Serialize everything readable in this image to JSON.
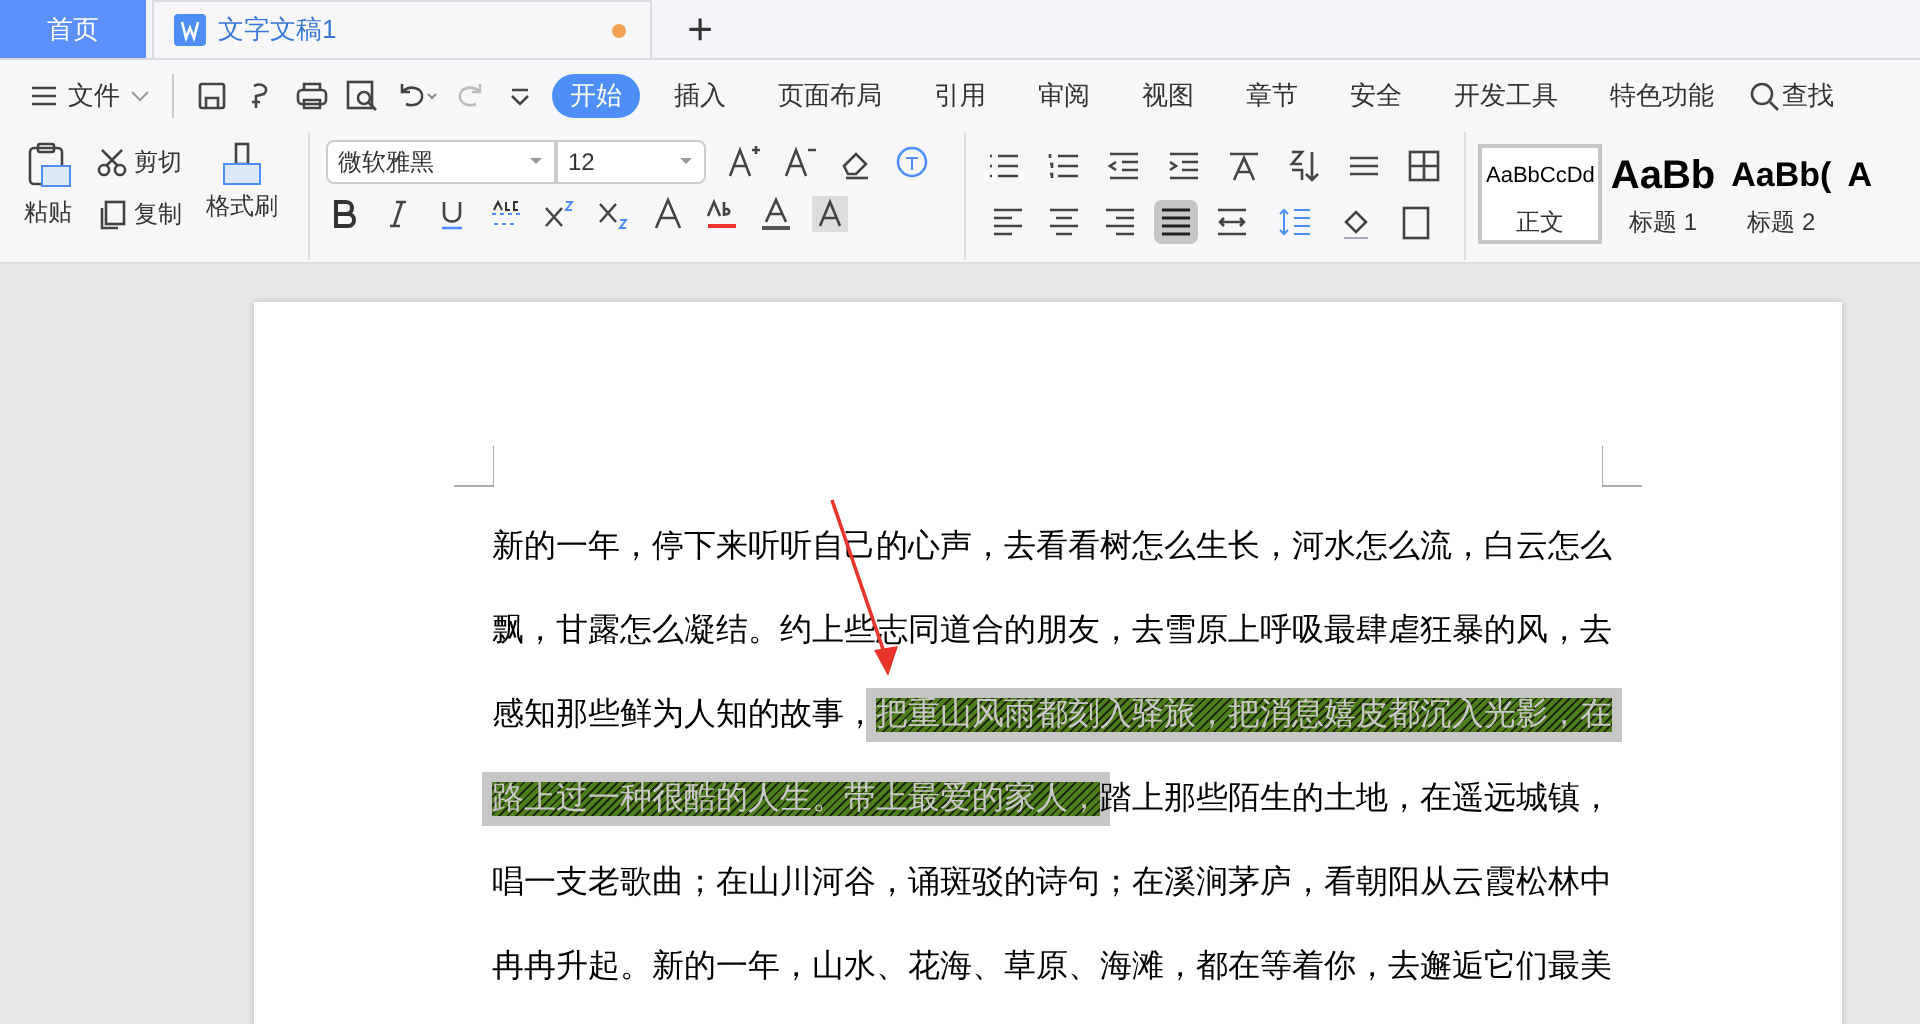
{
  "tabs": [
    {
      "label": "首页",
      "kind": "home",
      "selected": false
    },
    {
      "label": "文字文稿1",
      "kind": "document",
      "selected": true,
      "unsaved": true
    }
  ],
  "new_tab": "+",
  "menu": {
    "file": "文件",
    "ribbon_tabs": [
      {
        "label": "开始",
        "selected": true
      },
      {
        "label": "插入",
        "selected": false
      },
      {
        "label": "页面布局",
        "selected": false
      },
      {
        "label": "引用",
        "selected": false
      },
      {
        "label": "审阅",
        "selected": false
      },
      {
        "label": "视图",
        "selected": false
      },
      {
        "label": "章节",
        "selected": false
      },
      {
        "label": "安全",
        "selected": false
      },
      {
        "label": "开发工具",
        "selected": false
      },
      {
        "label": "特色功能",
        "selected": false
      }
    ],
    "search": "查找"
  },
  "clipboard": {
    "paste": "粘贴",
    "cut": "剪切",
    "copy": "复制",
    "format_painter": "格式刷"
  },
  "font": {
    "name": "微软雅黑",
    "size": "12"
  },
  "alignment": [
    {
      "kind": "left",
      "selected": false
    },
    {
      "kind": "center",
      "selected": false
    },
    {
      "kind": "right",
      "selected": false
    },
    {
      "kind": "justify",
      "selected": true
    },
    {
      "kind": "distributed",
      "selected": false
    }
  ],
  "styles": [
    {
      "preview": "AaBbCcDd",
      "label": "正文",
      "kind": "body",
      "selected": true
    },
    {
      "preview": "AaBb",
      "label": "标题 1",
      "kind": "h1",
      "selected": false
    },
    {
      "preview": "AaBb(",
      "label": "标题 2",
      "kind": "h2",
      "selected": false
    },
    {
      "preview": "A",
      "kind": "h3",
      "selected": false
    }
  ],
  "document": {
    "lines": [
      [
        {
          "text": "新的一年，停下来听听自己的心声，去看看树怎么生长，河水怎么流，白云怎么",
          "selected": false
        }
      ],
      [
        {
          "text": "飘，甘露怎么凝结。约上些志同道合的朋友，去雪原上呼吸最肆虐狂暴的风，去",
          "selected": false
        }
      ],
      [
        {
          "text": "感知那些鲜为人知的故事，",
          "selected": false
        },
        {
          "text": "把重山风雨都刻入驿旅，把消息嬉皮都沉入光影，在",
          "selected": true
        }
      ],
      [
        {
          "text": "路上过一种很酷的人生。带上最爱的家人，",
          "selected": true
        },
        {
          "text": "踏上那些陌生的土地，在遥远城镇，",
          "selected": false
        }
      ],
      [
        {
          "text": "唱一支老歌曲；在山川河谷，诵斑驳的诗句；在溪涧茅庐，看朝阳从云霞松林中",
          "selected": false
        }
      ],
      [
        {
          "text": "冉冉升起。新的一年，山水、花海、草原、海滩，都在等着你，去邂逅它们最美",
          "selected": false
        }
      ]
    ]
  }
}
